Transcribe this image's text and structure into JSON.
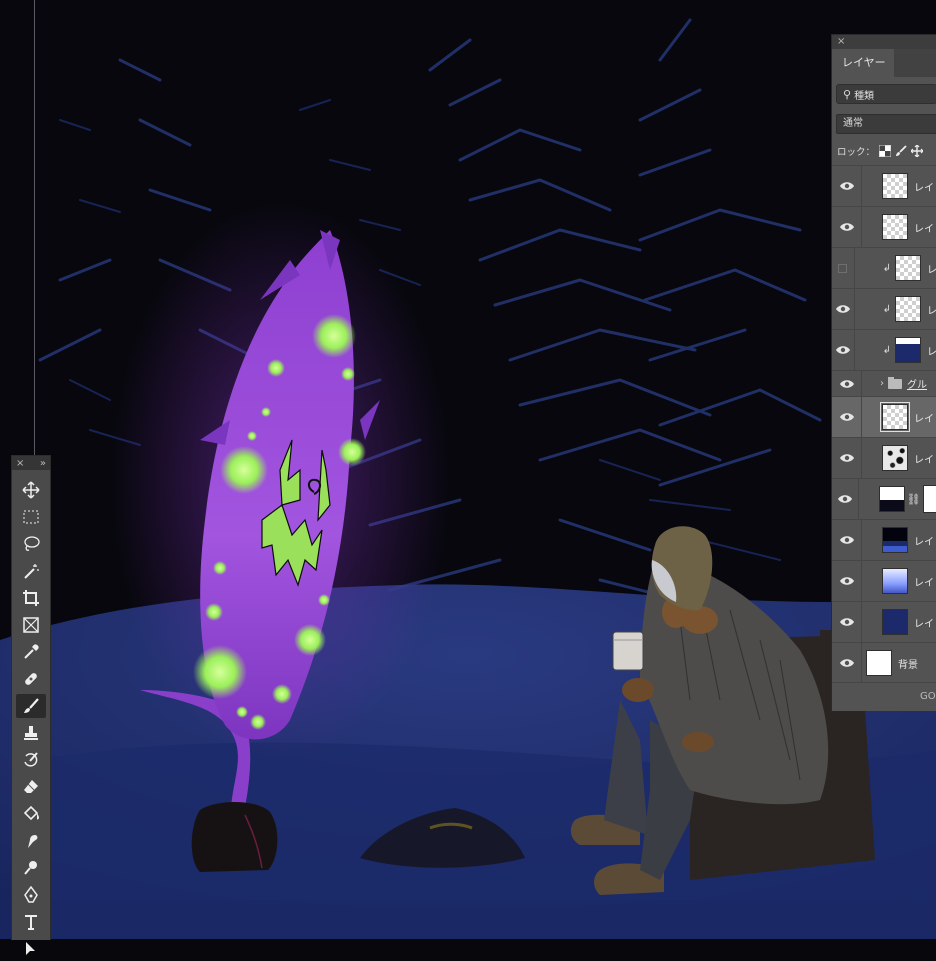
{
  "layers_panel": {
    "close": "×",
    "tab_label": "レイヤー",
    "filter_kind": "種類",
    "blend_mode": "通常",
    "lock_label": "ロック：",
    "layers": [
      {
        "name": "レイ",
        "visible": true,
        "clipped": false,
        "thumb": "checker"
      },
      {
        "name": "レイ",
        "visible": true,
        "clipped": false,
        "thumb": "checker"
      },
      {
        "name": "レ",
        "visible": false,
        "clipped": true,
        "thumb": "checker"
      },
      {
        "name": "レ",
        "visible": true,
        "clipped": true,
        "thumb": "checker"
      },
      {
        "name": "レ",
        "visible": true,
        "clipped": true,
        "thumb": "navy-top"
      },
      {
        "name": "グル",
        "visible": true,
        "group": true
      },
      {
        "name": "レイ",
        "visible": true,
        "selected": true,
        "thumb": "checker"
      },
      {
        "name": "レイ",
        "visible": true,
        "thumb": "noise"
      },
      {
        "name": "",
        "visible": true,
        "thumb": "mixed",
        "linked_mask": true
      },
      {
        "name": "レイ",
        "visible": true,
        "thumb": "night"
      },
      {
        "name": "レイ",
        "visible": true,
        "thumb": "sky"
      },
      {
        "name": "レイ",
        "visible": true,
        "thumb": "navy"
      },
      {
        "name": "背景",
        "visible": true,
        "thumb": "white"
      }
    ],
    "footer_link": "GO"
  },
  "tools_panel": {
    "close": "×",
    "expand": "»",
    "tools": [
      "move-tool",
      "marquee-tool",
      "lasso-tool",
      "magic-wand-tool",
      "crop-tool",
      "frame-tool",
      "eyedropper-tool",
      "healing-brush-tool",
      "brush-tool",
      "clone-stamp-tool",
      "history-brush-tool",
      "eraser-tool",
      "paint-bucket-tool",
      "smudge-tool",
      "dodge-tool",
      "pen-tool",
      "type-tool",
      "path-selection-tool"
    ],
    "active_tool": "brush-tool"
  },
  "colors": {
    "spirit_purple": "#9b4fd6",
    "spirit_glow": "#9bf05a",
    "snow_blue": "#1e2f73",
    "panel_bg": "#535353"
  }
}
